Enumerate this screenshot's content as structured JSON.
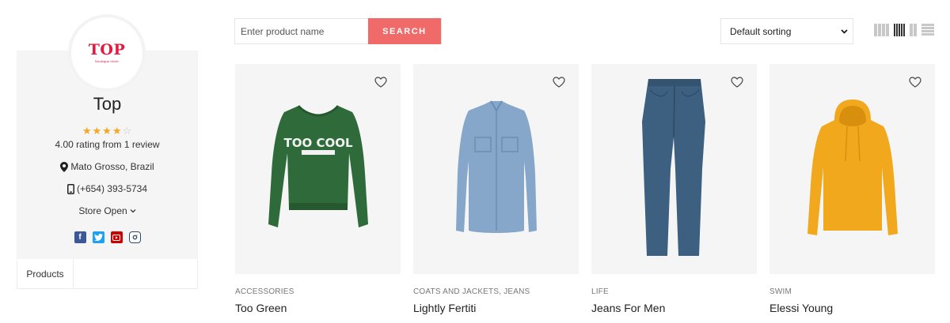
{
  "store": {
    "logo_text": "TOP",
    "logo_sub": "boutique store",
    "name": "Top",
    "rating_stars": 4,
    "rating_max": 5,
    "rating_text": "4.00 rating from 1 review",
    "location": "Mato Grosso, Brazil",
    "phone": "(+654) 393-5734",
    "hours_label": "Store Open",
    "social_icons": [
      "facebook-icon",
      "twitter-icon",
      "youtube-icon",
      "instagram-icon"
    ],
    "tabs": [
      {
        "label": "Products"
      }
    ]
  },
  "toolbar": {
    "search_placeholder": "Enter product name",
    "search_button": "SEARCH",
    "sort_selected": "Default sorting"
  },
  "colors": {
    "accent": "#f06a6a",
    "star": "#f6a623",
    "logo": "#e5193f"
  },
  "products": [
    {
      "category": "ACCESSORIES",
      "name": "Too Green",
      "image": "green-sweatshirt"
    },
    {
      "category": "COATS AND JACKETS, JEANS",
      "name": "Lightly Fertiti",
      "image": "denim-shirt"
    },
    {
      "category": "LIFE",
      "name": "Jeans For Men",
      "image": "blue-jeans"
    },
    {
      "category": "SWIM",
      "name": "Elessi Young",
      "image": "yellow-hoodie"
    }
  ]
}
